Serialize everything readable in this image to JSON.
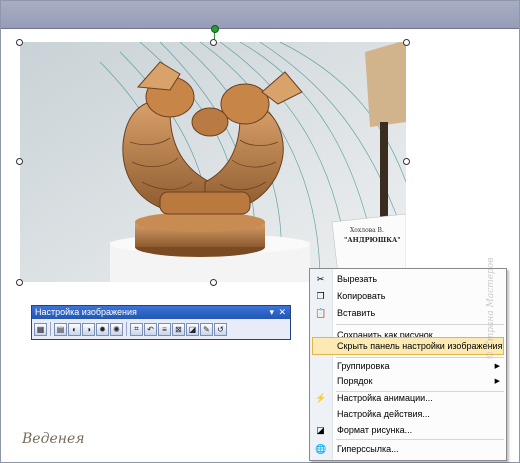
{
  "toolbar": {
    "title": "Настройка изображения",
    "dropdown_glyph": "▾",
    "close_glyph": "✕",
    "buttons": [
      "insert-picture-icon",
      "color-icon",
      "more-contrast-icon",
      "less-contrast-icon",
      "more-brightness-icon",
      "less-brightness-icon",
      "crop-icon",
      "rotate-icon",
      "line-style-icon",
      "compress-icon",
      "format-picture-icon",
      "transparent-color-icon",
      "reset-picture-icon"
    ]
  },
  "context_menu": {
    "items": [
      {
        "label": "Вырезать",
        "icon": "cut-icon"
      },
      {
        "label": "Копировать",
        "icon": "copy-icon"
      },
      {
        "label": "Вставить",
        "icon": "paste-icon"
      },
      {
        "label": "Сохранить как рисунок...",
        "icon": ""
      },
      {
        "label": "Скрыть панель настройки изображения",
        "icon": "",
        "highlighted": true
      },
      {
        "label": "Группировка",
        "icon": "",
        "submenu": true
      },
      {
        "label": "Порядок",
        "icon": "",
        "submenu": true
      },
      {
        "label": "Настройка анимации...",
        "icon": "animation-icon"
      },
      {
        "label": "Настройка действия...",
        "icon": ""
      },
      {
        "label": "Формат рисунка...",
        "icon": "format-picture-icon"
      },
      {
        "label": "Гиперссылка...",
        "icon": "hyperlink-icon"
      }
    ]
  },
  "photo": {
    "plaque_line1": "Хохлова В.",
    "plaque_line2": "\"АНДРЮШКА\""
  },
  "signature": "Веденея",
  "watermark": "© Страна Мастеров",
  "colors": {
    "titlebar": "#2456b4",
    "highlight": "#fbeab3"
  }
}
